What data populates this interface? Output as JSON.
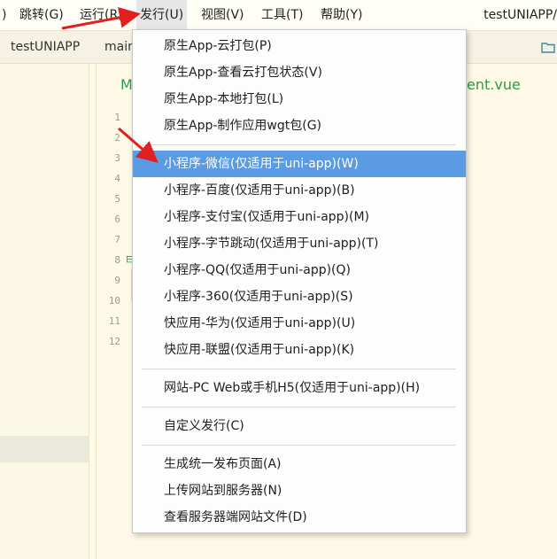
{
  "menubar": {
    "items": [
      {
        "label": ")"
      },
      {
        "label": "跳转(G)"
      },
      {
        "label": "运行(R)"
      },
      {
        "label": "发行(U)"
      },
      {
        "label": "视图(V)"
      },
      {
        "label": "工具(T)"
      },
      {
        "label": "帮助(Y)"
      }
    ],
    "app_title": "testUNIAPP/"
  },
  "tabs": [
    {
      "label": "testUNIAPP"
    },
    {
      "label": "main"
    }
  ],
  "editor": {
    "line_numbers": [
      "1",
      "2",
      "3",
      "4",
      "5",
      "6",
      "7",
      "8",
      "9",
      "10",
      "11",
      "12"
    ],
    "partial_left": "M",
    "partial_right": "ent.vue",
    "fold_marker": "⊟"
  },
  "dropdown": {
    "groups": [
      [
        {
          "label": "原生App-云打包(P)"
        },
        {
          "label": "原生App-查看云打包状态(V)"
        },
        {
          "label": "原生App-本地打包(L)"
        },
        {
          "label": "原生App-制作应用wgt包(G)"
        }
      ],
      [
        {
          "label": "小程序-微信(仅适用于uni-app)(W)",
          "highlighted": true
        },
        {
          "label": "小程序-百度(仅适用于uni-app)(B)"
        },
        {
          "label": "小程序-支付宝(仅适用于uni-app)(M)"
        },
        {
          "label": "小程序-字节跳动(仅适用于uni-app)(T)"
        },
        {
          "label": "小程序-QQ(仅适用于uni-app)(Q)"
        },
        {
          "label": "小程序-360(仅适用于uni-app)(S)"
        },
        {
          "label": "快应用-华为(仅适用于uni-app)(U)"
        },
        {
          "label": "快应用-联盟(仅适用于uni-app)(K)"
        }
      ],
      [
        {
          "label": "网站-PC Web或手机H5(仅适用于uni-app)(H)"
        }
      ],
      [
        {
          "label": "自定义发行(C)"
        }
      ],
      [
        {
          "label": "生成统一发布页面(A)"
        },
        {
          "label": "上传网站到服务器(N)"
        },
        {
          "label": "查看服务器端网站文件(D)"
        }
      ]
    ]
  },
  "colors": {
    "highlight": "#5b9be3",
    "annotation_arrow": "#e02020",
    "editor_bg": "#fffae7",
    "code_green": "#2c9a4a"
  }
}
